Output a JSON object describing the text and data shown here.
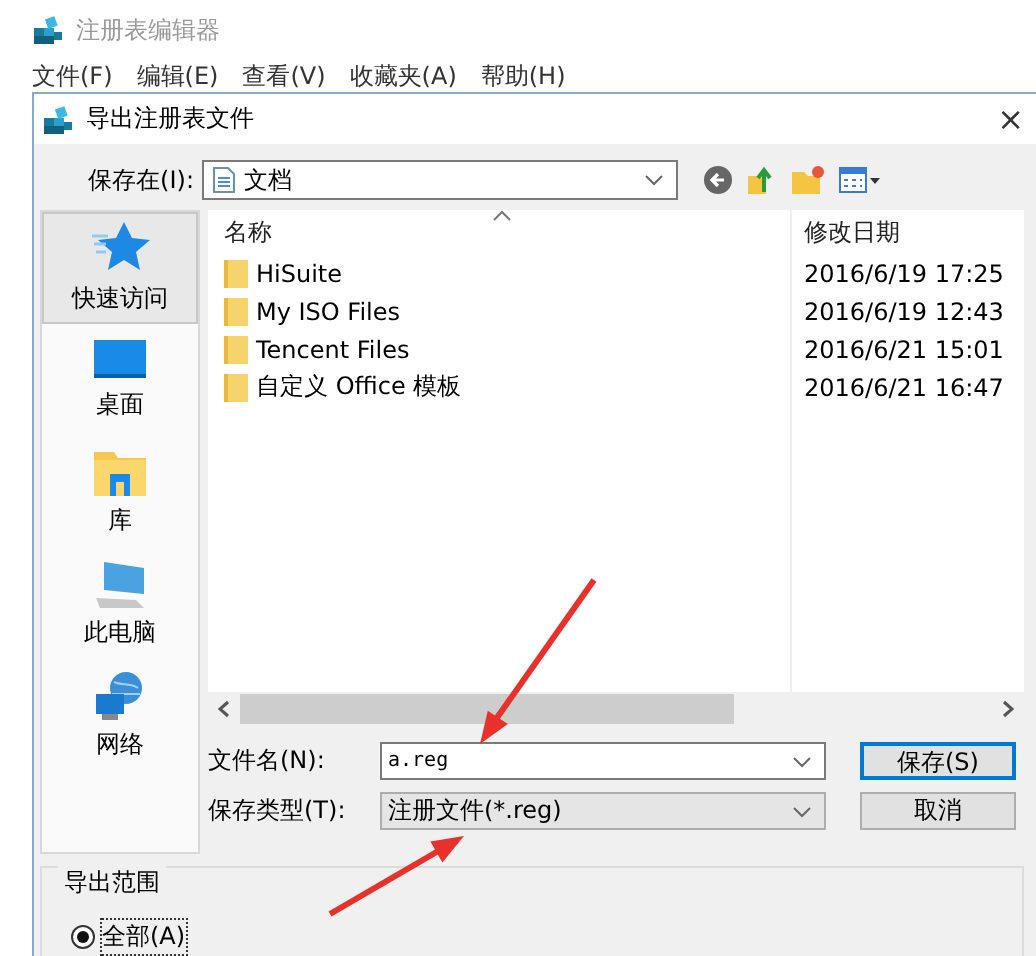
{
  "app_title": "注册表编辑器",
  "menu": [
    "文件(F)",
    "编辑(E)",
    "查看(V)",
    "收藏夹(A)",
    "帮助(H)"
  ],
  "dialog": {
    "title": "导出注册表文件",
    "close": "×",
    "save_in": {
      "label": "保存在(I):",
      "value": "文档"
    },
    "places": [
      {
        "label": "快速访问",
        "kind": "quick",
        "selected": true
      },
      {
        "label": "桌面",
        "kind": "desktop",
        "selected": false
      },
      {
        "label": "库",
        "kind": "library",
        "selected": false
      },
      {
        "label": "此电脑",
        "kind": "computer",
        "selected": false
      },
      {
        "label": "网络",
        "kind": "network",
        "selected": false
      }
    ],
    "columns": [
      "名称",
      "修改日期"
    ],
    "files": [
      {
        "name": "HiSuite",
        "modified": "2016/6/19 17:25"
      },
      {
        "name": "My ISO Files",
        "modified": "2016/6/19 12:43"
      },
      {
        "name": "Tencent Files",
        "modified": "2016/6/21 15:01"
      },
      {
        "name": "自定义 Office 模板",
        "modified": "2016/6/21 16:47"
      }
    ],
    "filename": {
      "label": "文件名(N):",
      "value": "a.reg"
    },
    "filetype": {
      "label": "保存类型(T):",
      "value": "注册文件(*.reg)"
    },
    "buttons": [
      {
        "label": "保存(S)",
        "default": true
      },
      {
        "label": "取消",
        "default": false
      }
    ],
    "export_range": {
      "title": "导出范围",
      "options": [
        {
          "label": "全部(A)",
          "selected": true
        }
      ]
    }
  }
}
